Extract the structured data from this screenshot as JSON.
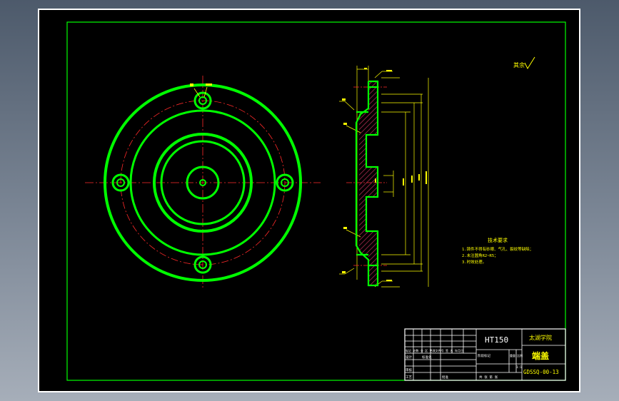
{
  "colors": {
    "background": "#000000",
    "outline": "#00ff00",
    "centerline": "#ff2a2a",
    "dimension": "#ffff00",
    "text": "#ffff00",
    "hatch": "#c0305a",
    "frame": "#00ff00",
    "titleblock": "#ffffff"
  },
  "title_block": {
    "material": "HT150",
    "school": "太湖学院",
    "part_name": "端盖",
    "drawing_number": "GDSSQ-00-13",
    "sheet_info": "共 张 第 张",
    "revision_cols": "标记 处数 分 区 更改文件号 签 名 年月日",
    "design_label": "设计",
    "standard_label": "标准化",
    "review_label": "审核",
    "process_label": "工艺",
    "approve_label": "批准",
    "stage_label": "阶段标记",
    "weight_label": "重量",
    "scale_label": "比例",
    "scale_value": "1:1"
  },
  "notes": {
    "heading": "技术要求",
    "line1": "1.铸件不得有砂眼、气孔、裂纹等缺陷；",
    "line2": "2.未注圆角R2~R5；",
    "line3": "3.时效处理。"
  },
  "roughness_label": "其余"
}
